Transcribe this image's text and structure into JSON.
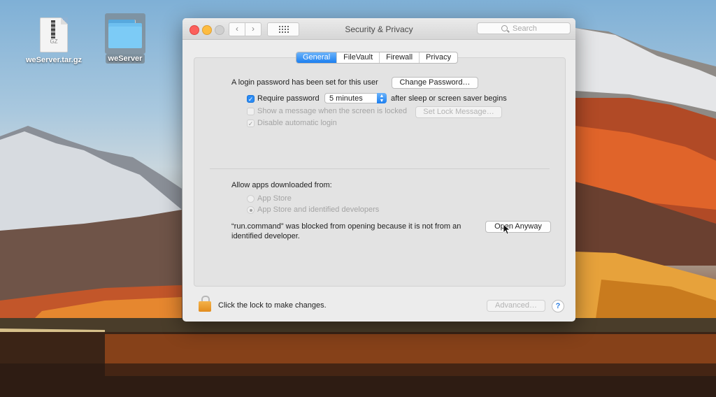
{
  "desktop": {
    "icons": [
      {
        "label": "weServer.tar.gz",
        "icon": "gz-archive-icon",
        "ext": "GZ"
      },
      {
        "label": "weServer",
        "icon": "folder-icon"
      }
    ]
  },
  "window": {
    "title": "Security & Privacy",
    "search_placeholder": "Search",
    "nav": {
      "back": "‹",
      "forward": "›"
    },
    "tabs": [
      {
        "label": "General",
        "active": true
      },
      {
        "label": "FileVault",
        "active": false
      },
      {
        "label": "Firewall",
        "active": false
      },
      {
        "label": "Privacy",
        "active": false
      }
    ],
    "general": {
      "login_text": "A login password has been set for this user",
      "change_password_label": "Change Password…",
      "require_password_label": "Require password",
      "require_password_checked": true,
      "require_password_value": "5 minutes",
      "after_sleep_text": "after sleep or screen saver begins",
      "show_message_label": "Show a message when the screen is locked",
      "set_lock_message_label": "Set Lock Message…",
      "disable_login_label": "Disable automatic login",
      "allow_apps_label": "Allow apps downloaded from:",
      "radio_options": [
        {
          "label": "App Store",
          "selected": false
        },
        {
          "label": "App Store and identified developers",
          "selected": true
        }
      ],
      "blocked_line1": "“run.command” was blocked from opening because it is not from an",
      "blocked_line2": "identified developer.",
      "open_anyway_label": "Open Anyway"
    },
    "footer": {
      "lock_text": "Click the lock to make changes.",
      "advanced_label": "Advanced…",
      "help_label": "?"
    }
  },
  "colors": {
    "accent": "#1c7ff0",
    "lock": "#e9992d",
    "close": "#fc605c",
    "minimize": "#fdbc40"
  }
}
